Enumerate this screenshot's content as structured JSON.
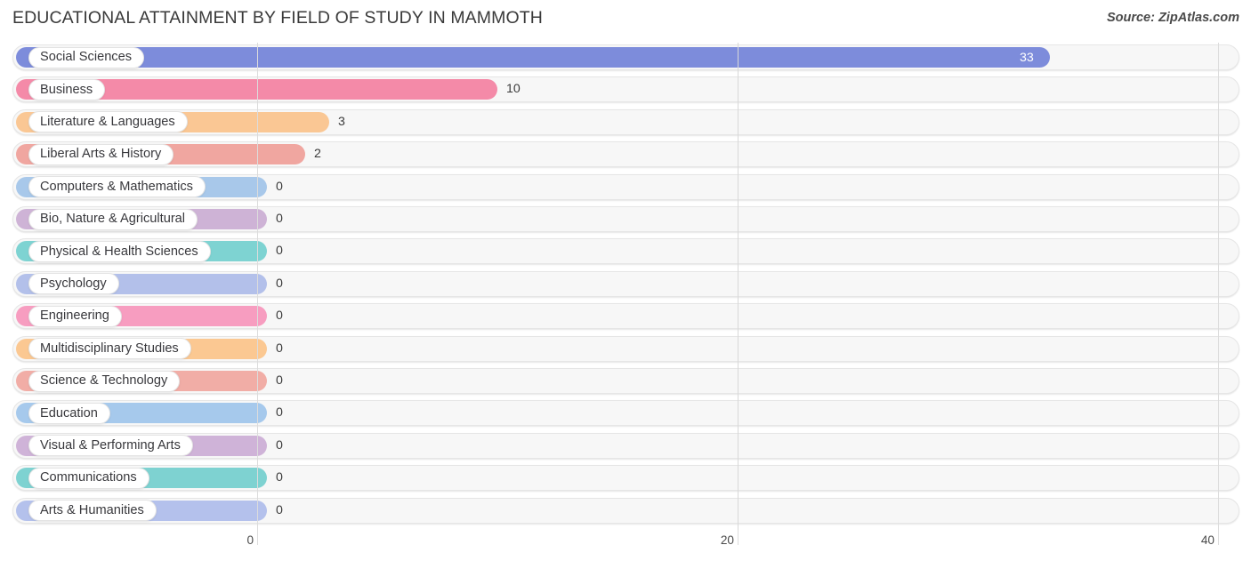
{
  "header": {
    "title": "EDUCATIONAL ATTAINMENT BY FIELD OF STUDY IN MAMMOTH",
    "source": "Source: ZipAtlas.com"
  },
  "chart_data": {
    "type": "bar",
    "orientation": "horizontal",
    "title": "EDUCATIONAL ATTAINMENT BY FIELD OF STUDY IN MAMMOTH",
    "xlabel": "",
    "ylabel": "",
    "xlim": [
      0,
      40
    ],
    "xticks": [
      0,
      20,
      40
    ],
    "xtick_labels": [
      "0",
      "20",
      "40"
    ],
    "grid": true,
    "legend": false,
    "categories": [
      "Social Sciences",
      "Business",
      "Literature & Languages",
      "Liberal Arts & History",
      "Computers & Mathematics",
      "Bio, Nature & Agricultural",
      "Physical & Health Sciences",
      "Psychology",
      "Engineering",
      "Multidisciplinary Studies",
      "Science & Technology",
      "Education",
      "Visual & Performing Arts",
      "Communications",
      "Arts & Humanities"
    ],
    "values": [
      33,
      10,
      3,
      2,
      0,
      0,
      0,
      0,
      0,
      0,
      0,
      0,
      0,
      0,
      0
    ],
    "value_labels": [
      "33",
      "10",
      "3",
      "2",
      "0",
      "0",
      "0",
      "0",
      "0",
      "0",
      "0",
      "0",
      "0",
      "0",
      "0"
    ],
    "colors": [
      "#7d8cdb",
      "#f48aa8",
      "#fac794",
      "#f0a6a0",
      "#a8c8ea",
      "#ceb3d6",
      "#7ed3d2",
      "#b3c0ea",
      "#f79dc0",
      "#fbc892",
      "#f1ada6",
      "#a6c9ec",
      "#cfb3d8",
      "#7ed2d1",
      "#b4c1ec"
    ]
  }
}
